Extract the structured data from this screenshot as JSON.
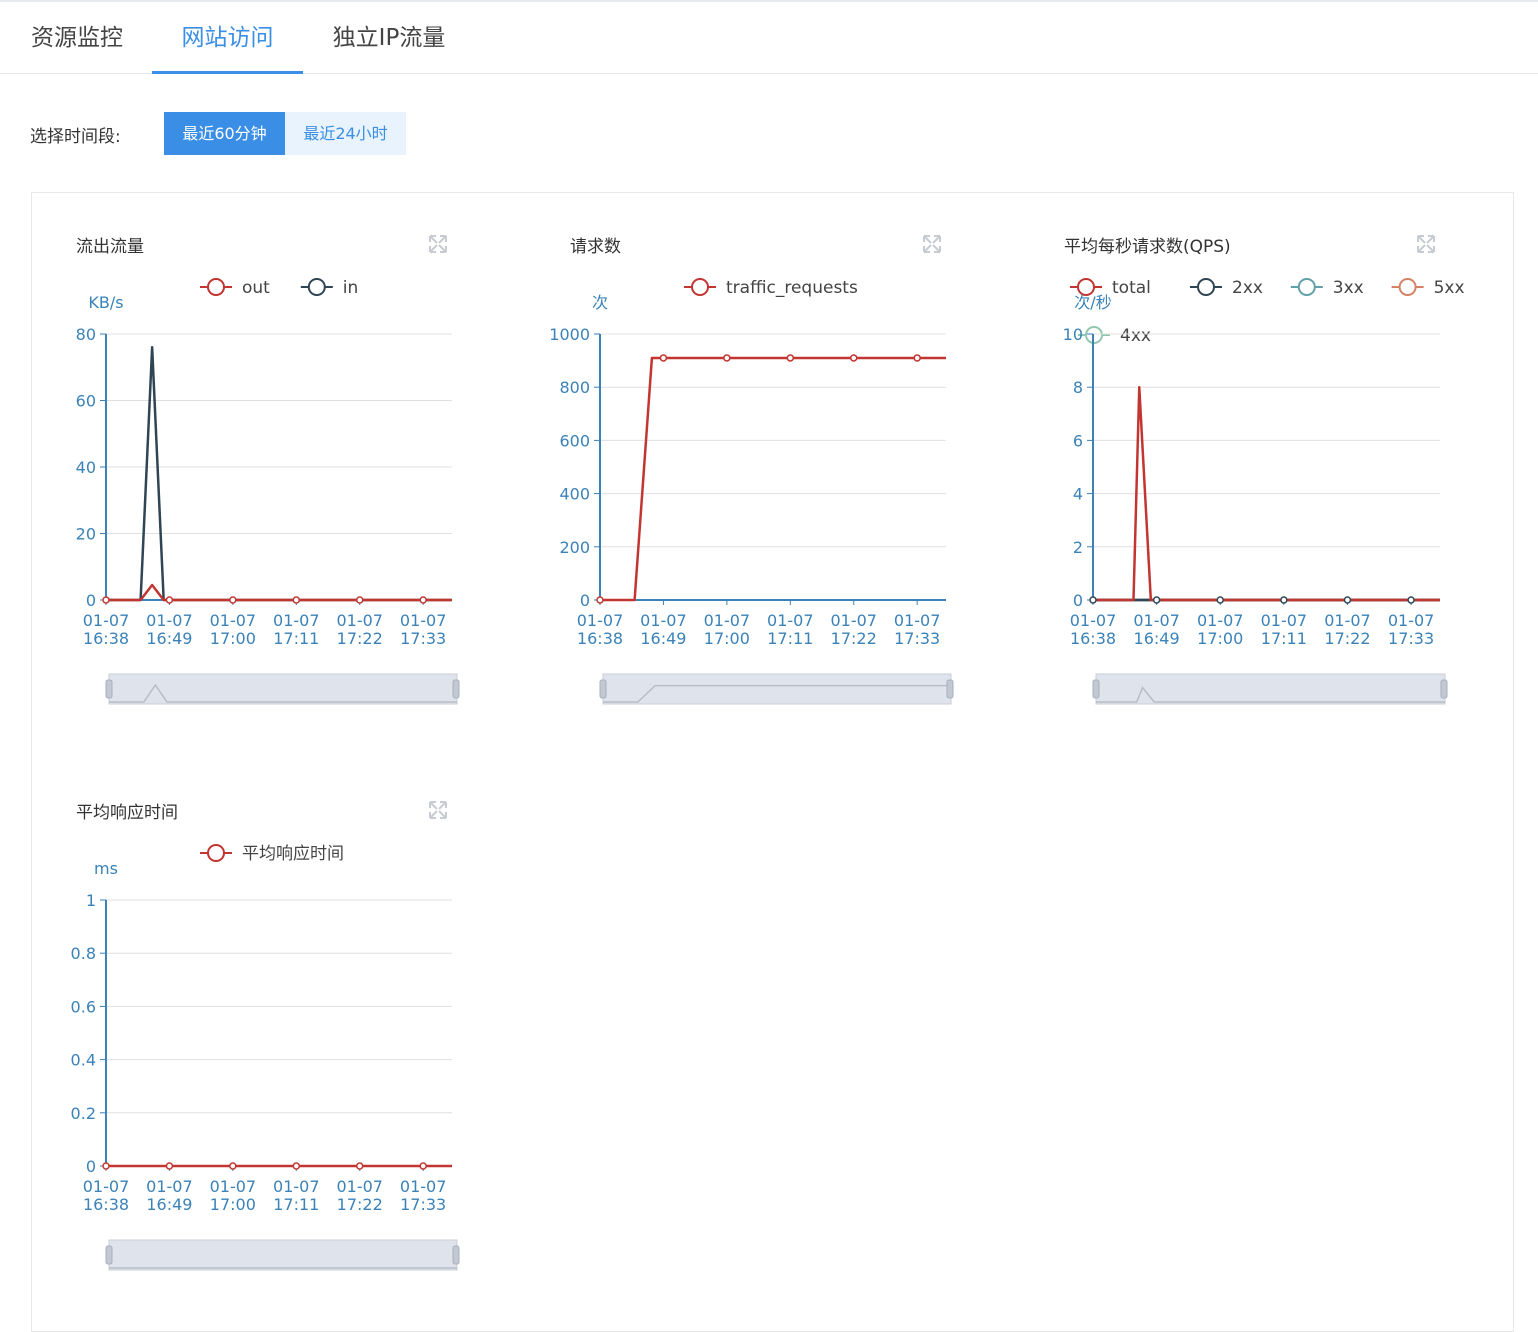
{
  "tabs": [
    {
      "label": "资源监控",
      "active": false
    },
    {
      "label": "网站访问",
      "active": true
    },
    {
      "label": "独立IP流量",
      "active": false
    }
  ],
  "time_range": {
    "label": "选择时间段:",
    "options": [
      {
        "label": "最近60分钟",
        "active": true
      },
      {
        "label": "最近24小时",
        "active": false
      }
    ]
  },
  "colors": {
    "accent": "#3a8ee6",
    "axis": "#3a82b8",
    "series_red": "#c23531",
    "series_dark": "#2f4554",
    "series_teal": "#61a0a8",
    "series_orange": "#d48265",
    "series_green": "#91c7ae"
  },
  "icons": {
    "expand": "expand-icon"
  },
  "chart_data": [
    {
      "type": "line",
      "title": "流出流量",
      "ylabel": "KB/s",
      "ylim": [
        0,
        80
      ],
      "yticks": [
        "0",
        "20",
        "40",
        "60",
        "80"
      ],
      "x": [
        "01-07\n16:38",
        "01-07\n16:49",
        "01-07\n17:00",
        "01-07\n17:11",
        "01-07\n17:22",
        "01-07\n17:33"
      ],
      "legend_position": "top-center",
      "grid": true,
      "series": [
        {
          "name": "out",
          "color": "#c23531",
          "points": [
            [
              0,
              0
            ],
            [
              6,
              0
            ],
            [
              8,
              4.5
            ],
            [
              10,
              0
            ],
            [
              60,
              0
            ]
          ]
        },
        {
          "name": "in",
          "color": "#2f4554",
          "points": [
            [
              0,
              0
            ],
            [
              6,
              0
            ],
            [
              8,
              76
            ],
            [
              10,
              0
            ],
            [
              60,
              0
            ]
          ]
        }
      ]
    },
    {
      "type": "line",
      "title": "请求数",
      "ylabel": "次",
      "ylim": [
        0,
        1000
      ],
      "yticks": [
        "0",
        "200",
        "400",
        "600",
        "800",
        "1000"
      ],
      "x": [
        "01-07\n16:38",
        "01-07\n16:49",
        "01-07\n17:00",
        "01-07\n17:11",
        "01-07\n17:22",
        "01-07\n17:33"
      ],
      "legend_position": "top-center",
      "grid": true,
      "series": [
        {
          "name": "traffic_requests",
          "color": "#c23531",
          "points": [
            [
              0,
              0
            ],
            [
              6,
              0
            ],
            [
              9,
              910
            ],
            [
              11,
              910
            ],
            [
              22,
              910
            ],
            [
              33,
              910
            ],
            [
              44,
              910
            ],
            [
              55,
              910
            ],
            [
              60,
              910
            ]
          ]
        }
      ]
    },
    {
      "type": "line",
      "title": "平均每秒请求数(QPS)",
      "ylabel": "次/秒",
      "ylim": [
        0,
        10
      ],
      "yticks": [
        "0",
        "2",
        "4",
        "6",
        "8",
        "10"
      ],
      "x": [
        "01-07\n16:38",
        "01-07\n16:49",
        "01-07\n17:00",
        "01-07\n17:11",
        "01-07\n17:22",
        "01-07\n17:33"
      ],
      "legend_position": "top-center",
      "grid": true,
      "series": [
        {
          "name": "total",
          "color": "#c23531",
          "points": [
            [
              0,
              0
            ],
            [
              7,
              0
            ],
            [
              8,
              8
            ],
            [
              10,
              0
            ],
            [
              60,
              0
            ]
          ]
        },
        {
          "name": "2xx",
          "color": "#2f4554",
          "points": [
            [
              0,
              0
            ],
            [
              60,
              0
            ]
          ]
        },
        {
          "name": "3xx",
          "color": "#61a0a8",
          "points": [
            [
              0,
              0
            ],
            [
              60,
              0
            ]
          ]
        },
        {
          "name": "5xx",
          "color": "#d48265",
          "points": [
            [
              0,
              0
            ],
            [
              60,
              0
            ]
          ]
        },
        {
          "name": "4xx",
          "color": "#91c7ae",
          "points": [
            [
              0,
              0
            ],
            [
              60,
              0
            ]
          ]
        }
      ]
    },
    {
      "type": "line",
      "title": "平均响应时间",
      "ylabel": "ms",
      "ylim": [
        0,
        1
      ],
      "yticks": [
        "0",
        "0.2",
        "0.4",
        "0.6",
        "0.8",
        "1"
      ],
      "x": [
        "01-07\n16:38",
        "01-07\n16:49",
        "01-07\n17:00",
        "01-07\n17:11",
        "01-07\n17:22",
        "01-07\n17:33"
      ],
      "legend_position": "top-center",
      "grid": true,
      "series": [
        {
          "name": "平均响应时间",
          "color": "#c23531",
          "points": [
            [
              0,
              0
            ],
            [
              60,
              0
            ]
          ]
        }
      ]
    }
  ]
}
